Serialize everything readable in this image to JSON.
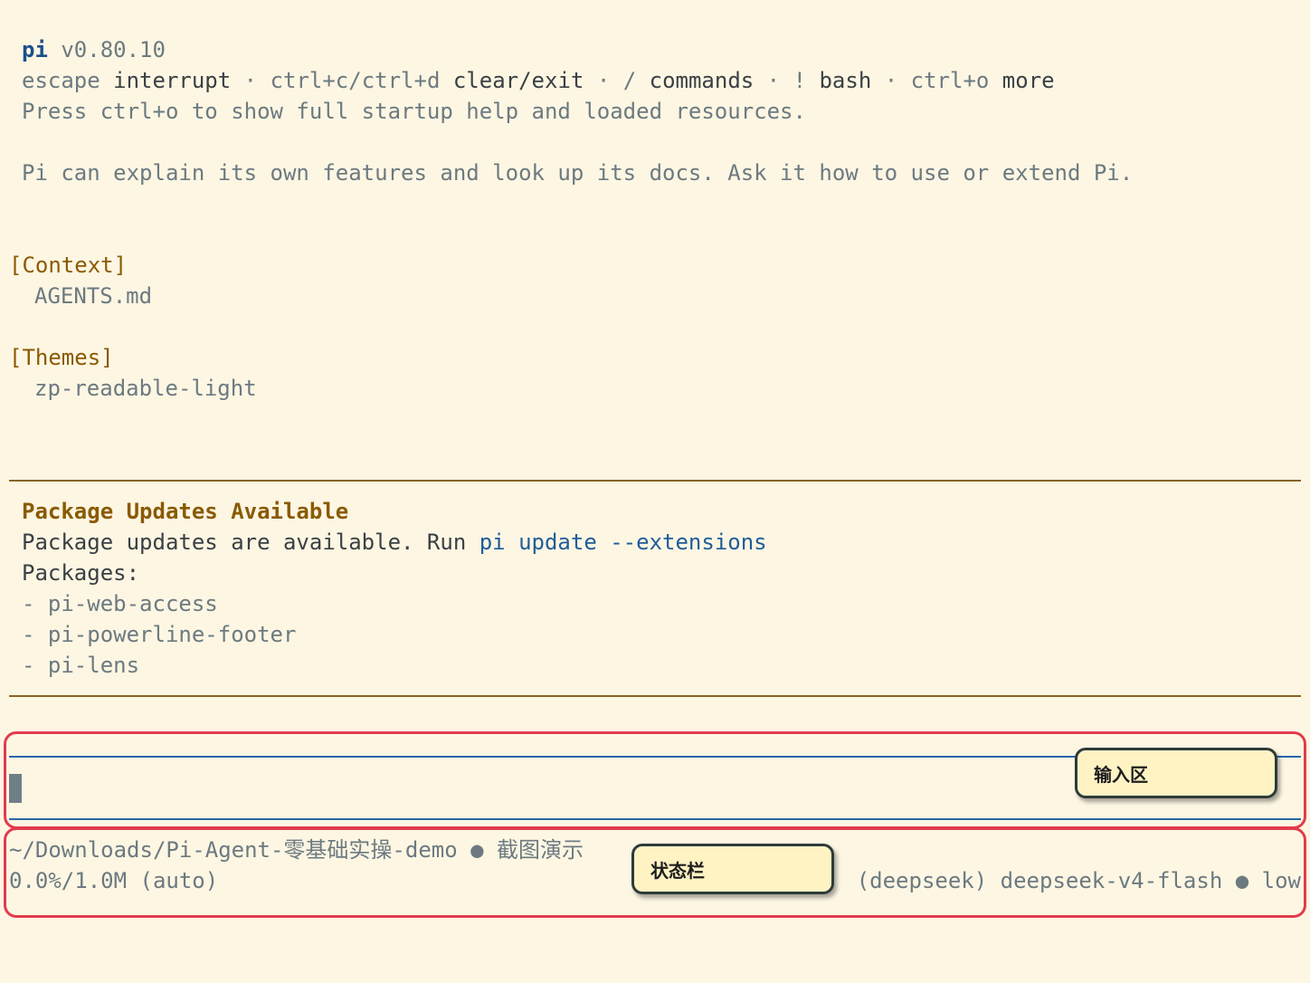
{
  "header": {
    "app_name": "pi",
    "version": "v0.80.10",
    "shortcuts": [
      {
        "key": "escape",
        "action": "interrupt"
      },
      {
        "key": "ctrl+c/ctrl+d",
        "action": "clear/exit"
      },
      {
        "key": "/",
        "action": "commands"
      },
      {
        "key": "!",
        "action": "bash"
      },
      {
        "key": "ctrl+o",
        "action": "more"
      }
    ],
    "separator": "·",
    "startup_hint": "Press ctrl+o to show full startup help and loaded resources.",
    "tip": "Pi can explain its own features and look up its docs. Ask it how to use or extend Pi."
  },
  "context": {
    "label": "[Context]",
    "items": [
      "AGENTS.md"
    ]
  },
  "themes": {
    "label": "[Themes]",
    "items": [
      "zp-readable-light"
    ]
  },
  "updates": {
    "title": "Package Updates Available",
    "message": "Package updates are available. Run ",
    "command": "pi update --extensions",
    "packages_label": "Packages:",
    "packages": [
      "- pi-web-access",
      "- pi-powerline-footer",
      "- pi-lens"
    ]
  },
  "input": {
    "value": ""
  },
  "status_bar": {
    "path": "~/Downloads/Pi-Agent-零基础实操-demo",
    "dot": "●",
    "session_name": "截图演示",
    "context_usage": "0.0%/1.0M (auto)",
    "model": "(deepseek) deepseek-v4-flash",
    "thinking_level": "low"
  },
  "annotations": {
    "input_label": "输入区",
    "status_label": "状态栏",
    "highlight_color": "#e23b4e",
    "callout_color": "#fff3c4"
  },
  "colors": {
    "background": "#fdf6e3",
    "accent": "#1f5c99",
    "section": "#8a5a00",
    "divider": "#8a6420",
    "input_border": "#2a66a8"
  }
}
